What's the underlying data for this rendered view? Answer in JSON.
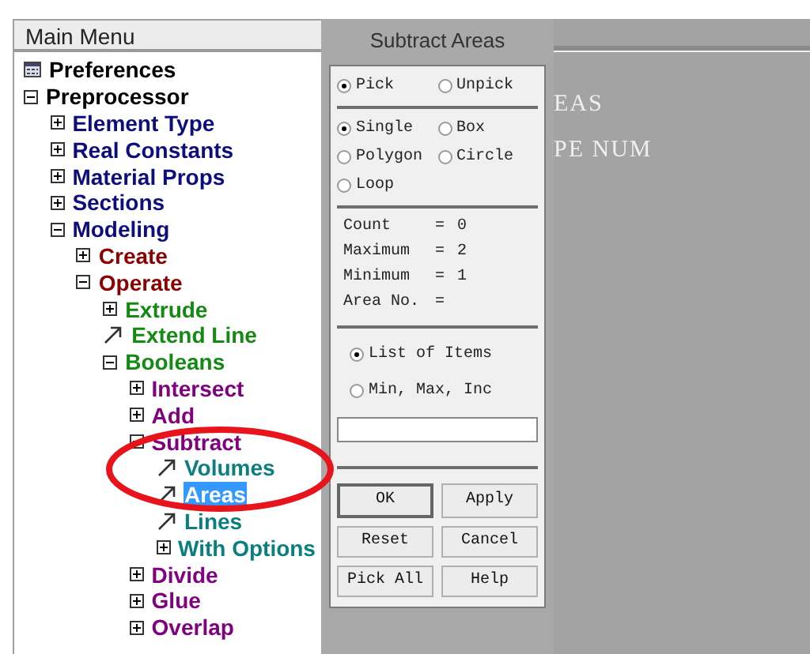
{
  "main_menu": {
    "title": "Main Menu",
    "tree": [
      {
        "label": "Preferences",
        "kind": "form",
        "selected": false
      },
      {
        "label": "Preprocessor",
        "kind": "folder",
        "expanded": true,
        "selected": false,
        "children": [
          {
            "label": "Element Type",
            "kind": "folder",
            "expanded": false,
            "selected": false
          },
          {
            "label": "Real Constants",
            "kind": "folder",
            "expanded": false,
            "selected": false
          },
          {
            "label": "Material Props",
            "kind": "folder",
            "expanded": false,
            "selected": false
          },
          {
            "label": "Sections",
            "kind": "folder",
            "expanded": false,
            "selected": false
          },
          {
            "label": "Modeling",
            "kind": "folder",
            "expanded": true,
            "selected": false,
            "children": [
              {
                "label": "Create",
                "kind": "folder",
                "expanded": false,
                "selected": false
              },
              {
                "label": "Operate",
                "kind": "folder",
                "expanded": true,
                "selected": false,
                "children": [
                  {
                    "label": "Extrude",
                    "kind": "folder",
                    "expanded": false,
                    "selected": false
                  },
                  {
                    "label": "Extend Line",
                    "kind": "action",
                    "selected": false
                  },
                  {
                    "label": "Booleans",
                    "kind": "folder",
                    "expanded": true,
                    "selected": false,
                    "children": [
                      {
                        "label": "Intersect",
                        "kind": "folder",
                        "expanded": false,
                        "selected": false
                      },
                      {
                        "label": "Add",
                        "kind": "folder",
                        "expanded": false,
                        "selected": false
                      },
                      {
                        "label": "Subtract",
                        "kind": "folder",
                        "expanded": true,
                        "selected": false,
                        "children": [
                          {
                            "label": "Volumes",
                            "kind": "action",
                            "selected": false
                          },
                          {
                            "label": "Areas",
                            "kind": "action",
                            "selected": true
                          },
                          {
                            "label": "Lines",
                            "kind": "action",
                            "selected": false
                          },
                          {
                            "label": "With Options",
                            "kind": "folder",
                            "expanded": false,
                            "selected": false
                          }
                        ]
                      },
                      {
                        "label": "Divide",
                        "kind": "folder",
                        "expanded": false,
                        "selected": false
                      },
                      {
                        "label": "Glue",
                        "kind": "folder",
                        "expanded": false,
                        "selected": false
                      },
                      {
                        "label": "Overlap",
                        "kind": "folder",
                        "expanded": false,
                        "selected": false
                      }
                    ]
                  }
                ]
              }
            ]
          }
        ]
      }
    ]
  },
  "dialog": {
    "title": "Subtract Areas",
    "pick_mode": [
      {
        "label": "Pick",
        "selected": true
      },
      {
        "label": "Unpick",
        "selected": false
      }
    ],
    "pick_shape": [
      {
        "label": "Single",
        "selected": true
      },
      {
        "label": "Box",
        "selected": false
      },
      {
        "label": "Polygon",
        "selected": false
      },
      {
        "label": "Circle",
        "selected": false
      },
      {
        "label": "Loop",
        "selected": false
      }
    ],
    "readouts": [
      {
        "label": "Count",
        "sign": "=",
        "value": "0"
      },
      {
        "label": "Maximum",
        "sign": "=",
        "value": "2"
      },
      {
        "label": "Minimum",
        "sign": "=",
        "value": "1"
      },
      {
        "label": "Area No.",
        "sign": "="
      }
    ],
    "list_mode": [
      {
        "label": "List of Items",
        "selected": true
      },
      {
        "label": "Min, Max, Inc",
        "selected": false
      }
    ],
    "buttons": [
      {
        "label": "OK",
        "default": true
      },
      {
        "label": "Apply",
        "default": false
      },
      {
        "label": "Reset",
        "default": false
      },
      {
        "label": "Cancel",
        "default": false
      },
      {
        "label": "Pick All",
        "default": false
      },
      {
        "label": "Help",
        "default": false
      }
    ]
  },
  "graphics": {
    "lines": [
      "EAS",
      "PE NUM"
    ]
  }
}
